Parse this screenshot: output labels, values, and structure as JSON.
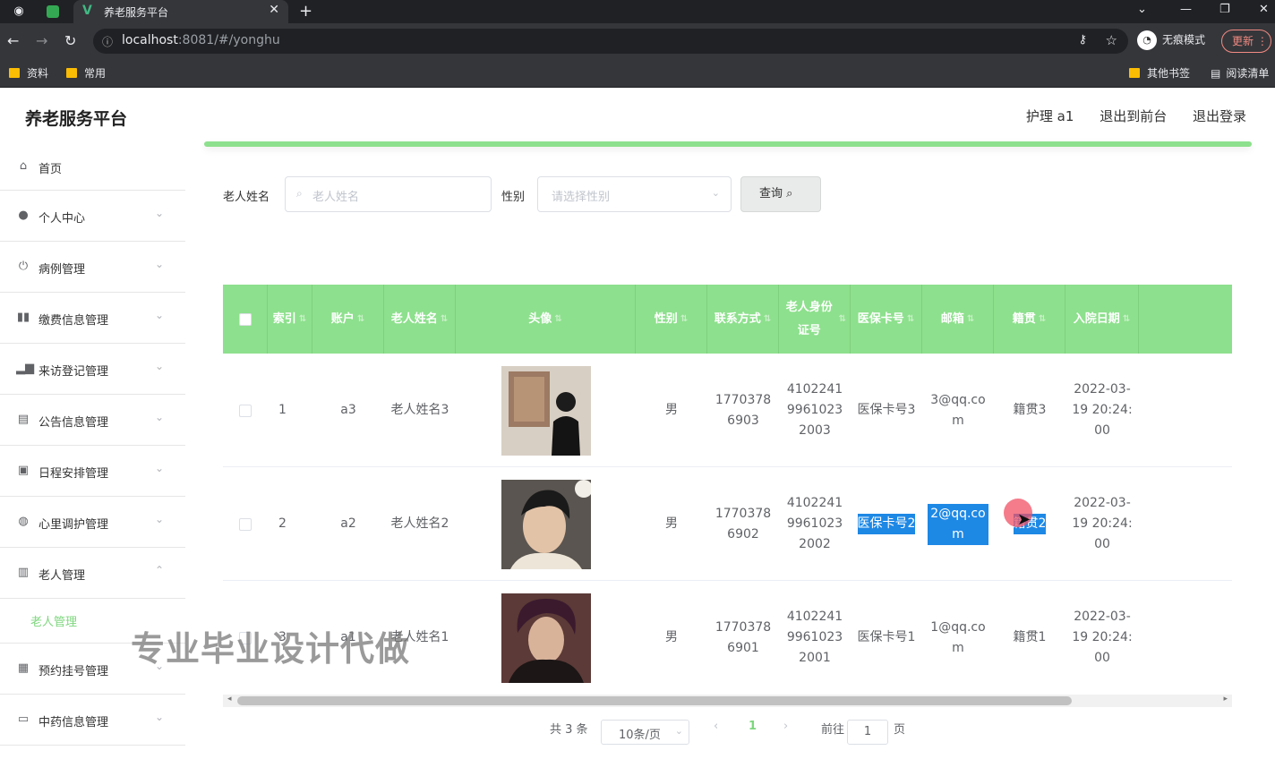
{
  "browser": {
    "tab_title": "养老服务平台",
    "url_host": "localhost",
    "url_rest": ":8081/#/yonghu",
    "incognito_label": "无痕模式",
    "update_label": "更新",
    "bookmarks": [
      "资料",
      "常用"
    ],
    "bookmarks_right": [
      "其他书签",
      "阅读清单"
    ]
  },
  "header": {
    "brand": "养老服务平台",
    "user": "护理 a1",
    "back_to_front": "退出到前台",
    "logout": "退出登录"
  },
  "sidebar": {
    "items": [
      {
        "label": "首页",
        "icon": "home-icon"
      },
      {
        "label": "个人中心",
        "icon": "user-icon"
      },
      {
        "label": "病例管理",
        "icon": "power-icon"
      },
      {
        "label": "缴费信息管理",
        "icon": "bars-icon"
      },
      {
        "label": "来访登记管理",
        "icon": "chart-icon"
      },
      {
        "label": "公告信息管理",
        "icon": "clipboard-icon"
      },
      {
        "label": "日程安排管理",
        "icon": "briefcase-icon"
      },
      {
        "label": "心里调护管理",
        "icon": "globe-icon"
      },
      {
        "label": "老人管理",
        "icon": "trash-icon"
      },
      {
        "label": "预约挂号管理",
        "icon": "grid-icon"
      },
      {
        "label": "中药信息管理",
        "icon": "card-icon"
      }
    ],
    "sub_active": "老人管理"
  },
  "search": {
    "name_label": "老人姓名",
    "name_placeholder": "老人姓名",
    "gender_label": "性别",
    "gender_placeholder": "请选择性别",
    "query_label": "查询"
  },
  "table": {
    "headers": [
      "索引",
      "账户",
      "老人姓名",
      "头像",
      "性别",
      "联系方式",
      "老人身份证号",
      "医保卡号",
      "邮箱",
      "籍贯",
      "入院日期"
    ],
    "rows": [
      {
        "index": "1",
        "account": "a3",
        "name": "老人姓名3",
        "gender": "男",
        "phone": "17703786903",
        "idcard": "410224199610232003",
        "card": "医保卡号3",
        "email": "3@qq.com",
        "native": "籍贯3",
        "date": "2022-03-19 20:24:00"
      },
      {
        "index": "2",
        "account": "a2",
        "name": "老人姓名2",
        "gender": "男",
        "phone": "17703786902",
        "idcard": "410224199610232002",
        "card": "医保卡号2",
        "email": "2@qq.com",
        "native": "籍贯2",
        "date": "2022-03-19 20:24:00"
      },
      {
        "index": "3",
        "account": "a1",
        "name": "老人姓名1",
        "gender": "男",
        "phone": "17703786901",
        "idcard": "410224199610232001",
        "card": "医保卡号1",
        "email": "1@qq.com",
        "native": "籍贯1",
        "date": "2022-03-19 20:24:00"
      }
    ]
  },
  "pagination": {
    "total": "共 3 条",
    "page_size": "10条/页",
    "current": "1",
    "goto_label": "前往",
    "goto_value": "1",
    "page_unit": "页"
  },
  "watermark": "专业毕业设计代做",
  "colors": {
    "accent": "#8de08d",
    "selection": "#1e88e5"
  }
}
